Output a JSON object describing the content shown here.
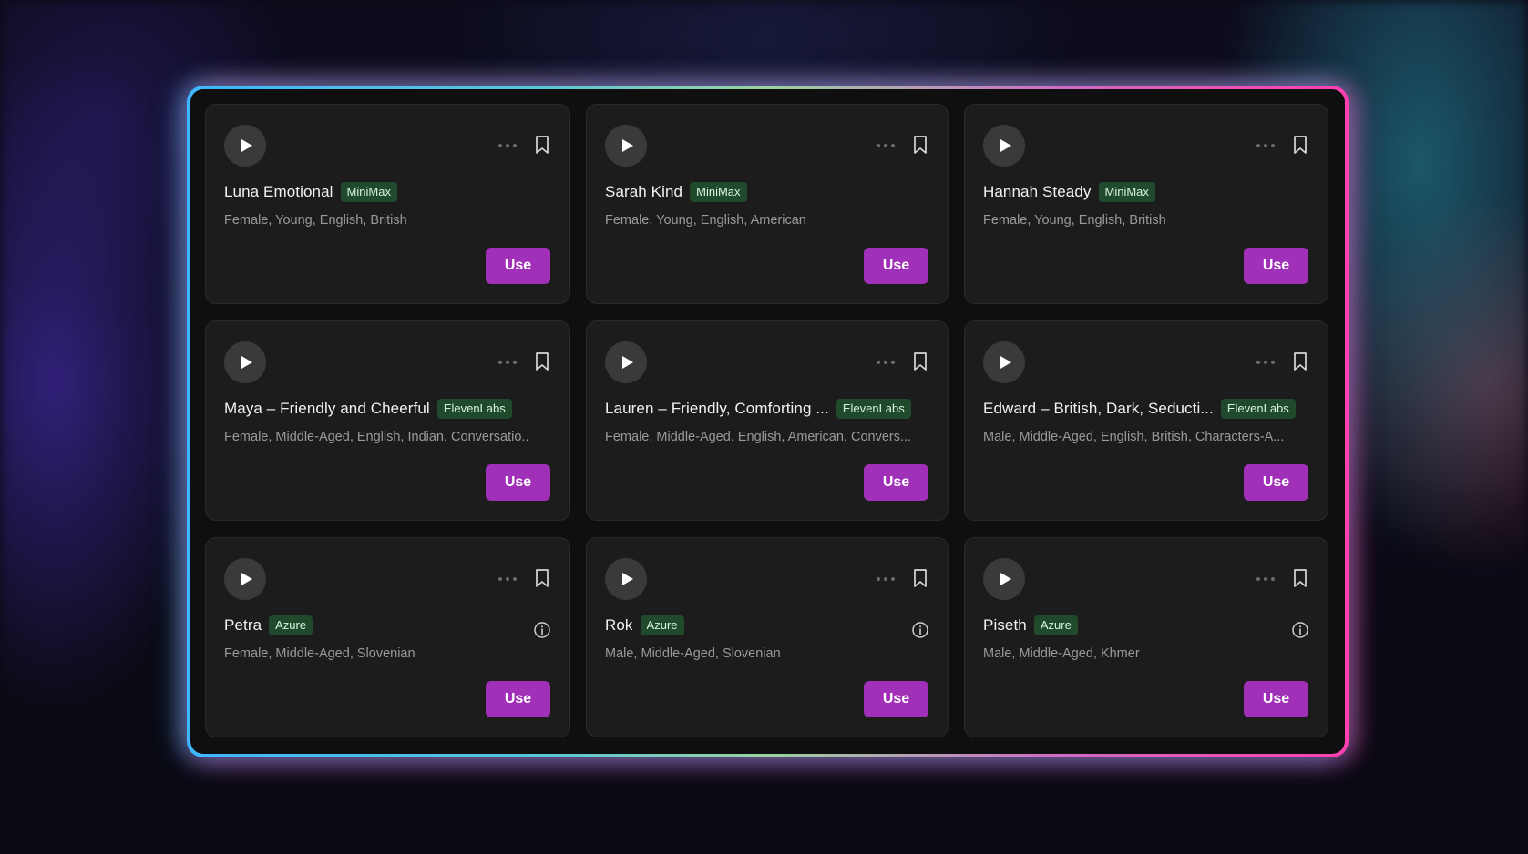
{
  "cards": [
    {
      "title": "Luna Emotional",
      "badge": "MiniMax",
      "desc": "Female, Young, English, British",
      "use_label": "Use",
      "info": false
    },
    {
      "title": "Sarah Kind",
      "badge": "MiniMax",
      "desc": "Female, Young, English, American",
      "use_label": "Use",
      "info": false
    },
    {
      "title": "Hannah Steady",
      "badge": "MiniMax",
      "desc": "Female, Young, English, British",
      "use_label": "Use",
      "info": false
    },
    {
      "title": "Maya – Friendly and Cheerful",
      "badge": "ElevenLabs",
      "desc": "Female, Middle-Aged, English, Indian, Conversatio..",
      "use_label": "Use",
      "info": false
    },
    {
      "title": "Lauren – Friendly, Comforting ...",
      "badge": "ElevenLabs",
      "desc": "Female, Middle-Aged, English, American, Convers...",
      "use_label": "Use",
      "info": false
    },
    {
      "title": "Edward – British, Dark, Seducti...",
      "badge": "ElevenLabs",
      "desc": "Male, Middle-Aged, English, British, Characters-A...",
      "use_label": "Use",
      "info": false
    },
    {
      "title": "Petra",
      "badge": "Azure",
      "desc": "Female, Middle-Aged, Slovenian",
      "use_label": "Use",
      "info": true
    },
    {
      "title": "Rok",
      "badge": "Azure",
      "desc": "Male, Middle-Aged, Slovenian",
      "use_label": "Use",
      "info": true
    },
    {
      "title": "Piseth",
      "badge": "Azure",
      "desc": "Male, Middle-Aged, Khmer",
      "use_label": "Use",
      "info": true
    }
  ],
  "icons": {
    "play": "play-icon",
    "more": "more-icon",
    "bookmark": "bookmark-icon",
    "info": "info-icon"
  },
  "colors": {
    "use_button": "#a030b8",
    "badge_bg": "#1f4a2c",
    "card_bg": "#1c1c1d",
    "frame_left": "#3fb6ff",
    "frame_right": "#ff3fb0"
  }
}
